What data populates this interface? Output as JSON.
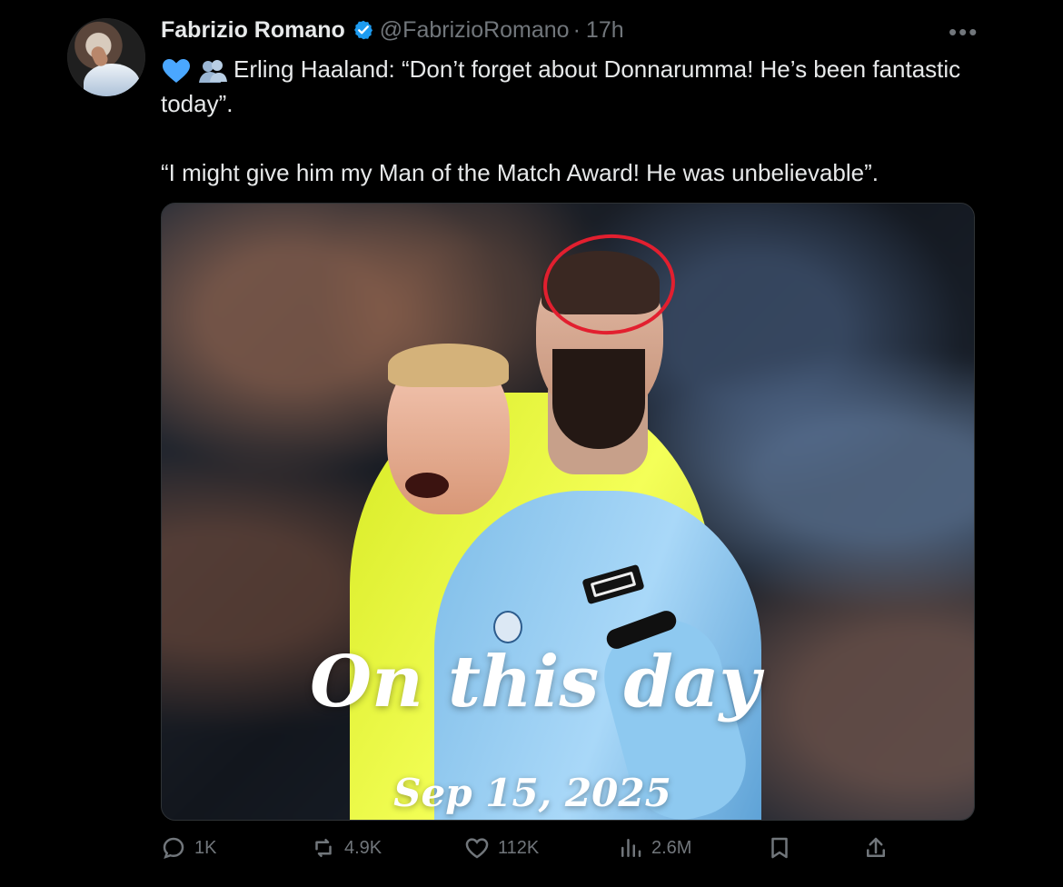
{
  "author": {
    "name": "Fabrizio Romano",
    "handle": "@FabrizioRomano",
    "time": "17h",
    "separator": "·"
  },
  "tweet": {
    "line1": "Erling Haaland: “Don’t forget about Donnarumma! He’s been fantastic today”.",
    "line2": "“I might give him my Man of the Match Award! He was unbelievable”."
  },
  "media": {
    "overlay_title": "On this day",
    "overlay_date": "Sep 15, 2025"
  },
  "stats": {
    "replies": "1K",
    "reposts": "4.9K",
    "likes": "112K",
    "views": "2.6M"
  },
  "icons": {
    "verified": "verified-badge-icon",
    "more": "more-horizontal-icon",
    "reply": "reply-icon",
    "repost": "repost-icon",
    "like": "heart-icon",
    "views": "views-icon",
    "bookmark": "bookmark-icon",
    "share": "share-icon"
  },
  "colors": {
    "background": "#000000",
    "text": "#e7e9ea",
    "muted": "#71767b",
    "verified": "#1d9bf0",
    "annotation": "#e21f2f"
  }
}
